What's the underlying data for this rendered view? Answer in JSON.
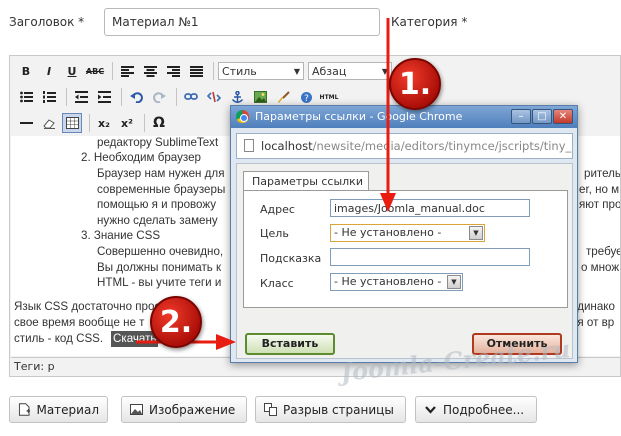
{
  "form": {
    "title_label": "Заголовок *",
    "title_value": "Материал №1",
    "category_label": "Категория *"
  },
  "toolbar": {
    "bold": "B",
    "italic": "I",
    "underline": "U",
    "strike": "ABC",
    "style_select": "Стиль",
    "format_select": "Абзац",
    "html": "HTML",
    "subscript": "x₂",
    "superscript": "x²",
    "omega": "Ω"
  },
  "content": {
    "lines": [
      "редактору SublimeText",
      "2.  Необходим браузер",
      "Браузер нам нужен для",
      "современные браузеры",
      "помощью я и провожу",
      "нужно сделать замену",
      "3.  Знание CSS",
      "Совершенно очевидно,",
      "Вы должны понимать к",
      "HTML - вы учите теги и",
      "Язык CSS достаточно прос",
      "свое время вообще не т",
      "стиль - код CSS.",
      "Скачать"
    ],
    "right_fragments": [
      "рительн",
      "er, но м",
      "яют про",
      "требуе",
      "о множ",
      "одинако",
      "ня от вр"
    ],
    "status": "Теги: p"
  },
  "bottom_buttons": [
    {
      "label": "Материал",
      "icon": "article-icon"
    },
    {
      "label": "Изображение",
      "icon": "image-icon"
    },
    {
      "label": "Разрыв страницы",
      "icon": "pagebreak-icon"
    },
    {
      "label": "Подробнее...",
      "icon": "chevron-down-icon"
    }
  ],
  "dialog": {
    "window_title": "Параметры ссылки - Google Chrome",
    "url_host": "localhost",
    "url_path": "/newsite/media/editors/tinymce/jscripts/tiny_mc",
    "tab_label": "Параметры ссылки",
    "fields": {
      "address_label": "Адрес",
      "address_value": "images/Joomla_manual.doc",
      "target_label": "Цель",
      "target_value": "- Не установлено -",
      "title_label": "Подсказка",
      "title_value": "",
      "class_label": "Класс",
      "class_value": "- Не установлено -"
    },
    "insert_button": "Вставить",
    "cancel_button": "Отменить"
  },
  "annotations": {
    "step1": "1.",
    "step2": "2.",
    "watermark": "Joomla-Create.ru",
    "arrow_color": "#e81c10",
    "badge_color": "#d3160b"
  }
}
